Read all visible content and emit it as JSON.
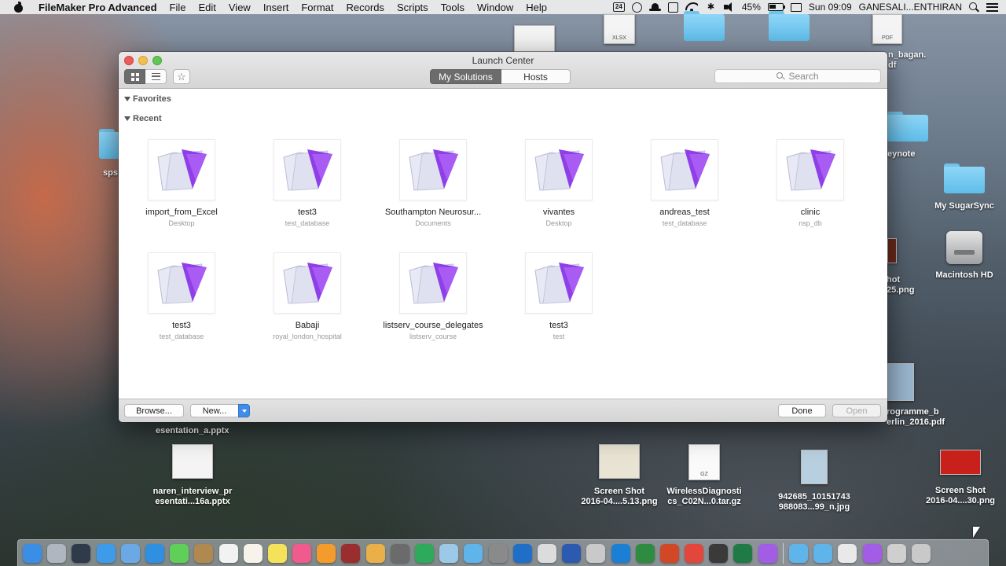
{
  "menubar": {
    "app_name": "FileMaker Pro Advanced",
    "menus": [
      "File",
      "Edit",
      "View",
      "Insert",
      "Format",
      "Records",
      "Scripts",
      "Tools",
      "Window",
      "Help"
    ],
    "calendar_badge": "24",
    "battery": "45%",
    "clock": "Sun 09:09",
    "user": "GANESALI...ENTHIRAN"
  },
  "desktop": {
    "icons": [
      {
        "label": "My SugarSync",
        "kind": "folder"
      },
      {
        "label": "Macintosh HD",
        "kind": "disk"
      },
      {
        "label": "naren_interview_pr\nesentati...16a.pptx",
        "kind": "pptx"
      },
      {
        "label": "Screen Shot\n2016-04....5.13.png",
        "kind": "image"
      },
      {
        "label": "WirelessDiagnosti\ncs_C02N...0.tar.gz",
        "kind": "archive"
      },
      {
        "label": "942685_10151743\n988083...99_n.jpg",
        "kind": "image"
      },
      {
        "label": "Screen Shot\n2016-04....30.png",
        "kind": "image"
      }
    ],
    "partial_labels": {
      "spss": "sps",
      "keynote": "eynote",
      "shot": "hot\n25.png",
      "programme": "rogramme_b\nerlin_2016.pdf",
      "presentation": "esentation_a.pptx",
      "bagan": "n_bagan.\ndf",
      "xlsx_tag": "XLSX",
      "pdf_tag": "PDF"
    }
  },
  "window": {
    "title": "Launch Center",
    "tabs": [
      {
        "label": "My Solutions",
        "active": true
      },
      {
        "label": "Hosts",
        "active": false
      }
    ],
    "search_placeholder": "Search",
    "sections": {
      "favorites": "Favorites",
      "recent": "Recent"
    },
    "files": [
      {
        "name": "import_from_Excel",
        "location": "Desktop"
      },
      {
        "name": "test3",
        "location": "test_database"
      },
      {
        "name": "Southampton Neurosur...",
        "location": "Documents"
      },
      {
        "name": "vivantes",
        "location": "Desktop"
      },
      {
        "name": "andreas_test",
        "location": "test_database"
      },
      {
        "name": "clinic",
        "location": "nsp_db"
      },
      {
        "name": "test3",
        "location": "test_database"
      },
      {
        "name": "Babaji",
        "location": "royal_london_hospital"
      },
      {
        "name": "listserv_course_delegates",
        "location": "listserv_course"
      },
      {
        "name": "test3",
        "location": "test"
      }
    ],
    "buttons": {
      "browse": "Browse...",
      "new": "New...",
      "done": "Done",
      "open": "Open"
    }
  },
  "colors": {
    "accent_blue": "#3f8de8",
    "fm_purple": "#9b3ef0",
    "tab_active": "#6c6c6c"
  },
  "dock": {
    "icons": [
      "finder-icon",
      "launchpad-icon",
      "mission-control-icon",
      "app-store-icon",
      "preview-icon",
      "safari-icon",
      "messages-icon",
      "contacts-icon",
      "calendar-icon",
      "notes-icon",
      "stickies-icon",
      "itunes-icon",
      "ibooks-icon",
      "photo-booth-icon",
      "photos-icon",
      "system-preferences-icon",
      "numbers-icon",
      "keynote-tools-icon",
      "folder-icon",
      "image-capture-icon",
      "outlook-icon",
      "keyboard-viewer-icon",
      "word-icon",
      "scanner-icon",
      "internet-explorer-icon",
      "sugarsync-icon",
      "powerpoint-icon",
      "chrome-icon",
      "video-icon",
      "excel-icon",
      "filemaker-icon",
      "documents-folder-icon",
      "downloads-folder-icon",
      "document-icon",
      "filemaker-doc-icon",
      "printer-icon",
      "trash-icon"
    ]
  }
}
